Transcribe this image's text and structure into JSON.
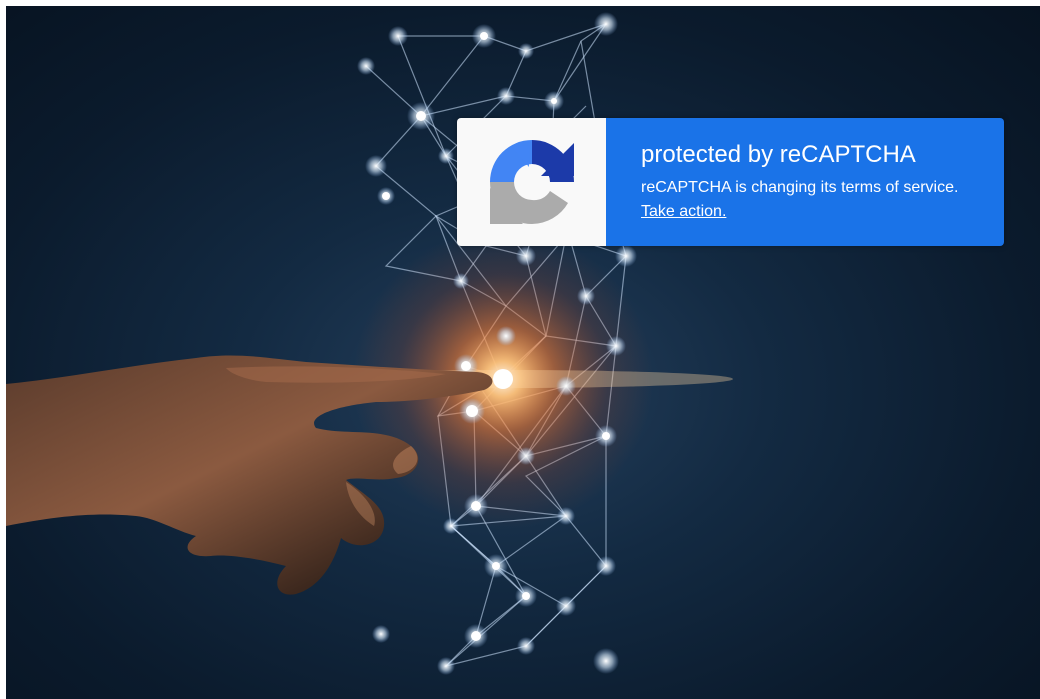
{
  "recaptcha": {
    "title_prefix": "protected by",
    "title_brand": "reCAPTCHA",
    "message": "reCAPTCHA is changing its terms of service.",
    "link_label": "Take action.",
    "logo_icon": "recaptcha-logo-icon"
  },
  "background": {
    "image_description_icon": "hand-touching-network-icon"
  },
  "colors": {
    "badge_blue": "#1a73e8",
    "logo_panel": "#f9f9f9",
    "logo_dark_blue": "#1c3aa9",
    "logo_blue": "#4285f4",
    "logo_gray": "#ababab",
    "glow": "#ff8a3d"
  }
}
